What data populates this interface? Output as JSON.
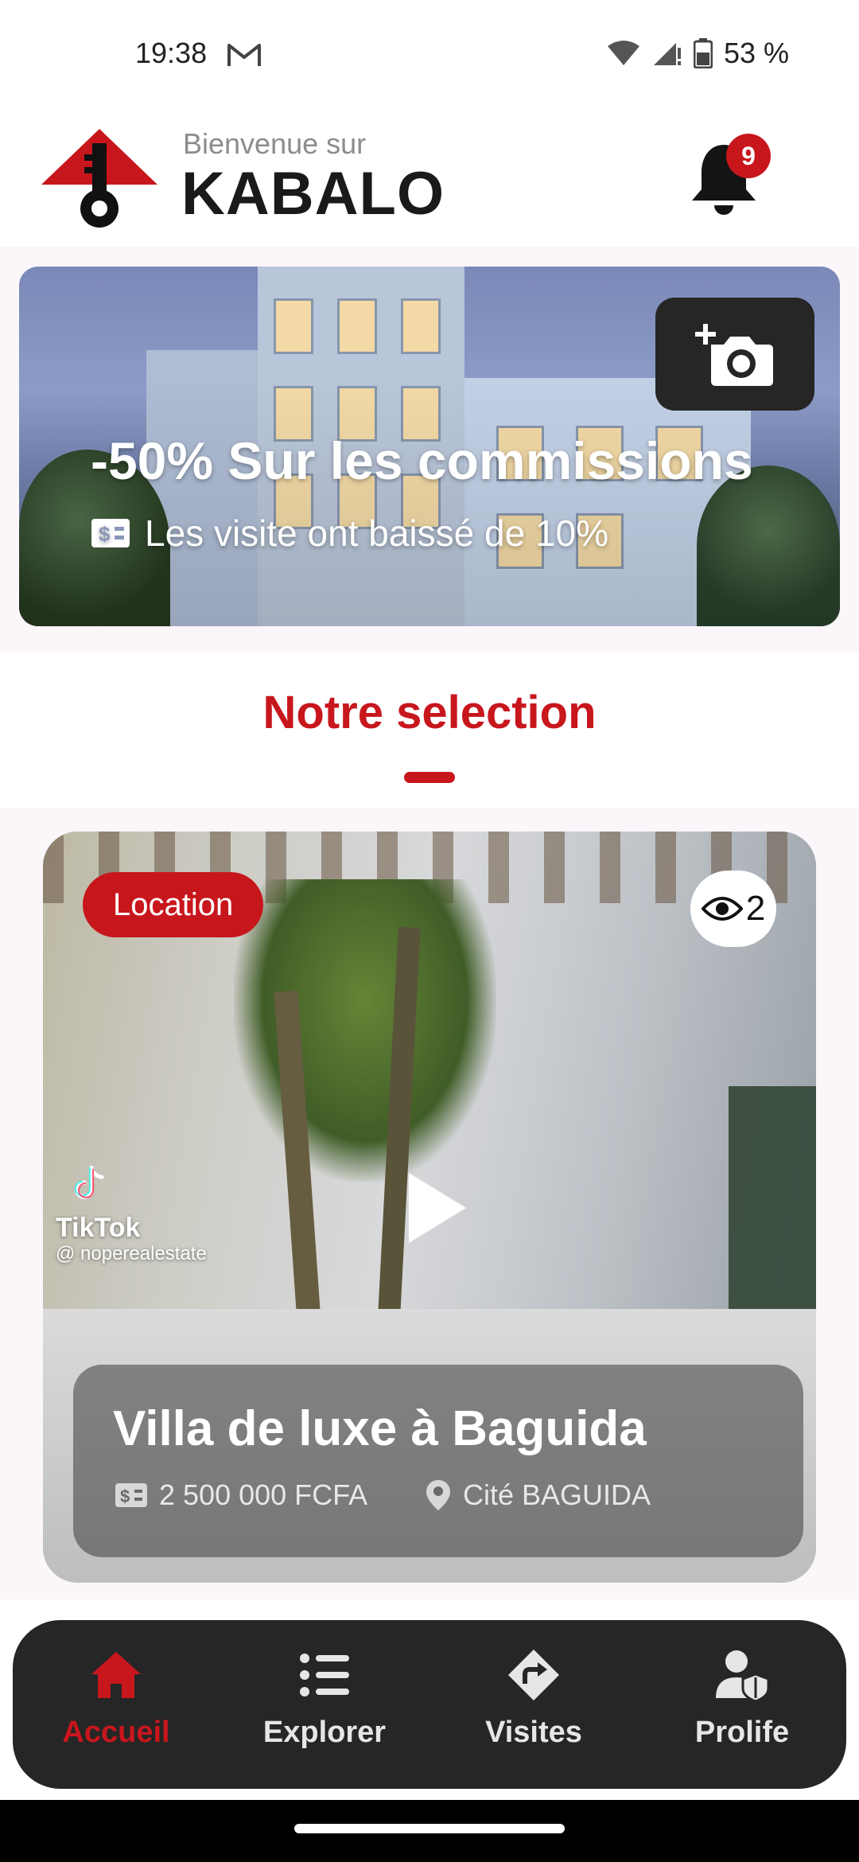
{
  "status_bar": {
    "time": "19:38",
    "battery": "53 %"
  },
  "header": {
    "welcome": "Bienvenue sur",
    "brand": "KABALO",
    "notification_count": "9"
  },
  "banner": {
    "title": "-50% Sur les commissions",
    "subtitle": "Les visite ont baissé de 10%"
  },
  "section": {
    "title": "Notre selection"
  },
  "listing": {
    "tag": "Location",
    "views": "2",
    "title": "Villa de luxe à Baguida",
    "price": "2 500 000 FCFA",
    "location": "Cité BAGUIDA",
    "watermark_app": "TikTok",
    "watermark_handle": "@ noperealestate"
  },
  "nav": {
    "items": [
      {
        "label": "Accueil",
        "icon": "home-icon",
        "active": true
      },
      {
        "label": "Explorer",
        "icon": "list-icon",
        "active": false
      },
      {
        "label": "Visites",
        "icon": "directions-icon",
        "active": false
      },
      {
        "label": "Prolife",
        "icon": "user-shield-icon",
        "active": false
      }
    ]
  },
  "colors": {
    "accent": "#c8161d",
    "nav_bg": "#262626",
    "content_bg": "#fbf6fa"
  }
}
